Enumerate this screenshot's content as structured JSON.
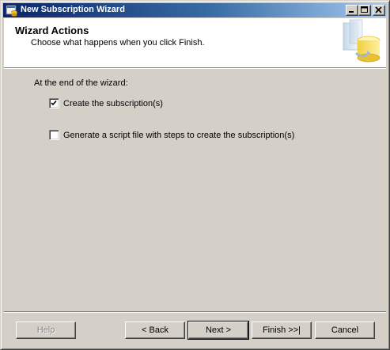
{
  "window": {
    "title": "New Subscription Wizard"
  },
  "header": {
    "title": "Wizard Actions",
    "subtitle": "Choose what happens when you click Finish."
  },
  "main": {
    "intro": "At the end of the wizard:",
    "options": [
      {
        "label": "Create the subscription(s)",
        "checked": true
      },
      {
        "label": "Generate a script file with steps to create the subscription(s)",
        "checked": false
      }
    ]
  },
  "buttons": {
    "help": "Help",
    "back": "< Back",
    "next": "Next >",
    "finish": "Finish >>|",
    "cancel": "Cancel"
  },
  "colors": {
    "titlebar_start": "#0a246a",
    "titlebar_end": "#a6caf0",
    "dialog_bg": "#d4d0c8"
  }
}
